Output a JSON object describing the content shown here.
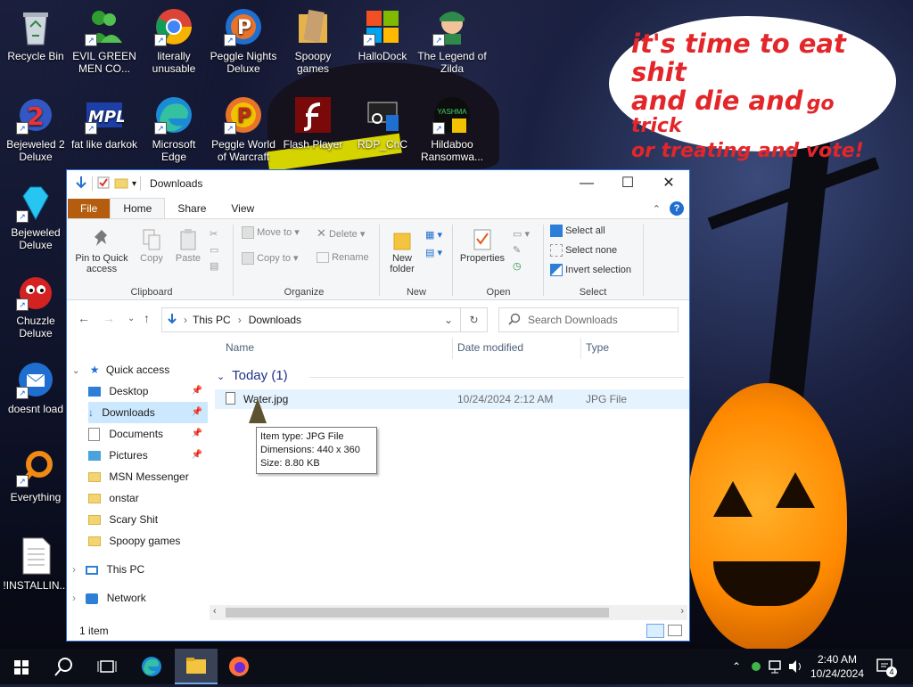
{
  "desktop": {
    "speech": {
      "line1": "it's time to eat shit",
      "line2a": "and die and",
      "line2b": "go trick",
      "line3": "or treating and vote!"
    },
    "icons": [
      {
        "label": "Recycle Bin",
        "icon": "recycle-bin-icon"
      },
      {
        "label": "EVIL GREEN MEN CO...",
        "icon": "msn-people-icon"
      },
      {
        "label": "literally unusable",
        "icon": "chrome-icon"
      },
      {
        "label": "Peggle Nights Deluxe",
        "icon": "peggle-icon"
      },
      {
        "label": "Spoopy games",
        "icon": "folder-icon"
      },
      {
        "label": "HalloDock",
        "icon": "windows-logo-icon"
      },
      {
        "label": "The Legend of Zilda",
        "icon": "zilda-icon"
      },
      {
        "label": "Bejeweled 2 Deluxe",
        "icon": "bejeweled2-icon"
      },
      {
        "label": "fat like darkok",
        "icon": "mpl-icon"
      },
      {
        "label": "Microsoft Edge",
        "icon": "edge-icon"
      },
      {
        "label": "Peggle World of Warcraft",
        "icon": "peggle-wow-icon"
      },
      {
        "label": "Flash Player",
        "icon": "flash-icon"
      },
      {
        "label": "RDP_CnC",
        "icon": "rdp-icon"
      },
      {
        "label": "Hildaboo Ransomwa...",
        "icon": "yashma-icon"
      },
      {
        "label": "Bejeweled Deluxe",
        "icon": "diamond-icon"
      },
      {
        "label": "Chuzzle Deluxe",
        "icon": "chuzzle-icon"
      },
      {
        "label": "doesnt load",
        "icon": "thunderbird-icon"
      },
      {
        "label": "Everything",
        "icon": "everything-search-icon"
      },
      {
        "label": "!INSTALLIN...",
        "icon": "text-document-icon"
      }
    ],
    "yashma_text": "YASHMA"
  },
  "explorer": {
    "title": "Downloads",
    "tabs": {
      "file": "File",
      "home": "Home",
      "share": "Share",
      "view": "View"
    },
    "help": "?",
    "ribbon": {
      "pin": "Pin to Quick access",
      "copy": "Copy",
      "paste": "Paste",
      "clipboard": "Clipboard",
      "move_to": "Move to",
      "copy_to": "Copy to",
      "delete": "Delete",
      "rename": "Rename",
      "organize": "Organize",
      "new_folder": "New folder",
      "new": "New",
      "properties": "Properties",
      "open": "Open",
      "select_all": "Select all",
      "select_none": "Select none",
      "invert_selection": "Invert selection",
      "select": "Select"
    },
    "address": {
      "this_pc": "This PC",
      "downloads": "Downloads"
    },
    "search_placeholder": "Search Downloads",
    "nav": {
      "quick_access": "Quick access",
      "items": [
        {
          "label": "Desktop",
          "pinned": true
        },
        {
          "label": "Downloads",
          "pinned": true
        },
        {
          "label": "Documents",
          "pinned": true
        },
        {
          "label": "Pictures",
          "pinned": true
        },
        {
          "label": "MSN Messenger",
          "pinned": false
        },
        {
          "label": "onstar",
          "pinned": false
        },
        {
          "label": "Scary Shit",
          "pinned": false
        },
        {
          "label": "Spoopy games",
          "pinned": false
        }
      ],
      "this_pc": "This PC",
      "network": "Network"
    },
    "columns": {
      "name": "Name",
      "date": "Date modified",
      "type": "Type"
    },
    "group": "Today (1)",
    "file": {
      "name": "Water.jpg",
      "date": "10/24/2024 2:12 AM",
      "type": "JPG File"
    },
    "tooltip": {
      "line1": "Item type: JPG File",
      "line2": "Dimensions: 440 x 360",
      "line3": "Size: 8.80 KB"
    },
    "status": "1 item"
  },
  "taskbar": {
    "time": "2:40 AM",
    "date": "10/24/2024",
    "notif_count": "4"
  }
}
